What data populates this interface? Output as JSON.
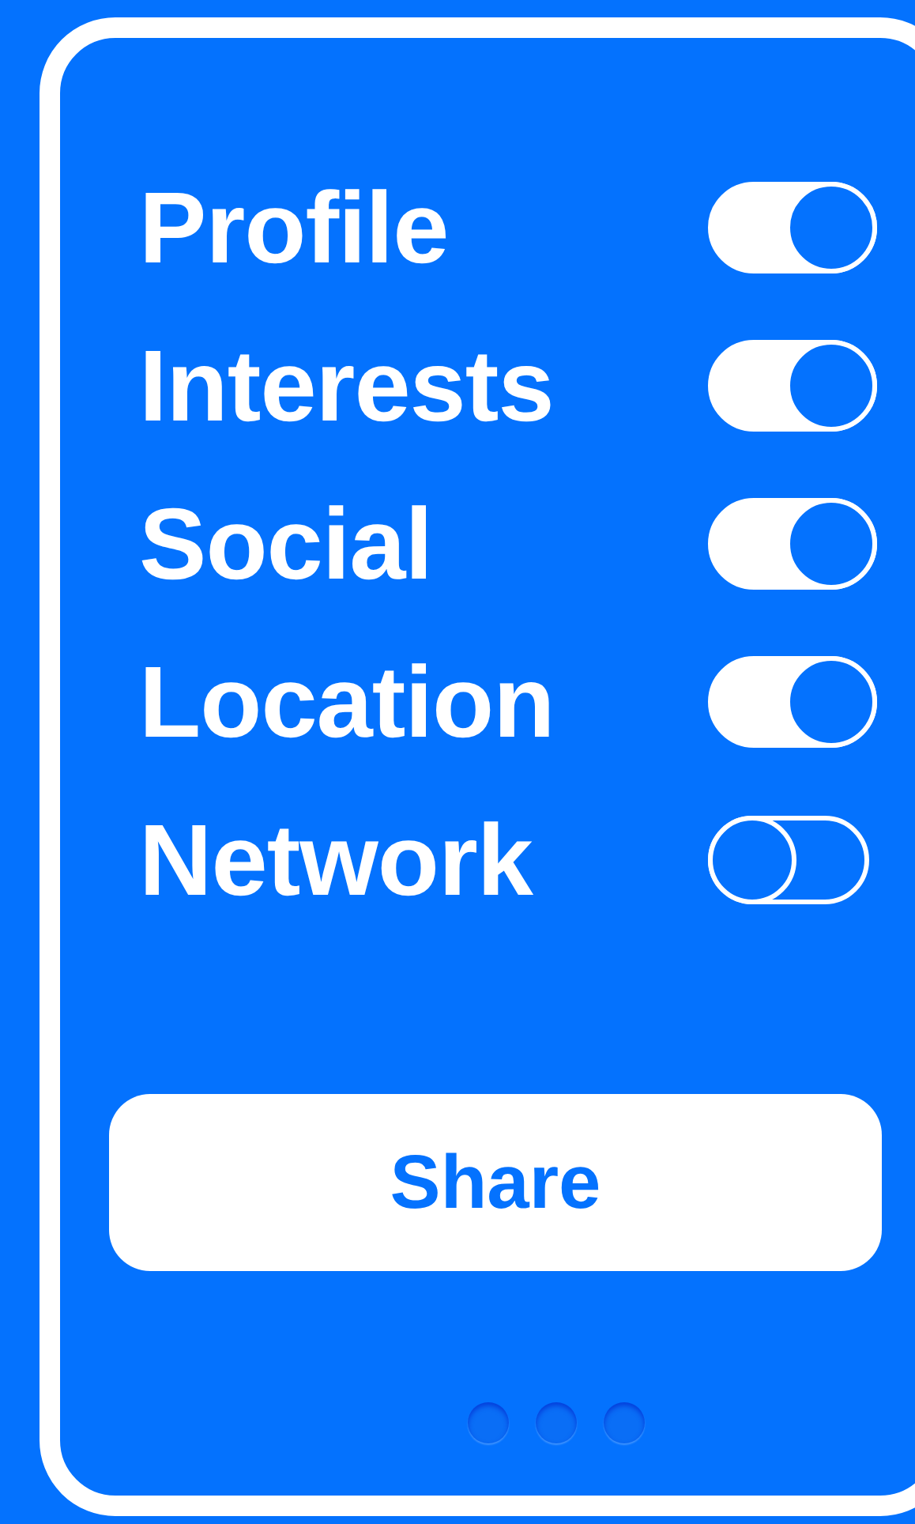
{
  "settings": [
    {
      "label": "Profile",
      "on": true
    },
    {
      "label": "Interests",
      "on": true
    },
    {
      "label": "Social",
      "on": true
    },
    {
      "label": "Location",
      "on": true
    },
    {
      "label": "Network",
      "on": false
    }
  ],
  "button": "Share",
  "pager": [
    {
      "selected": false
    },
    {
      "selected": false
    },
    {
      "selected": false
    }
  ]
}
